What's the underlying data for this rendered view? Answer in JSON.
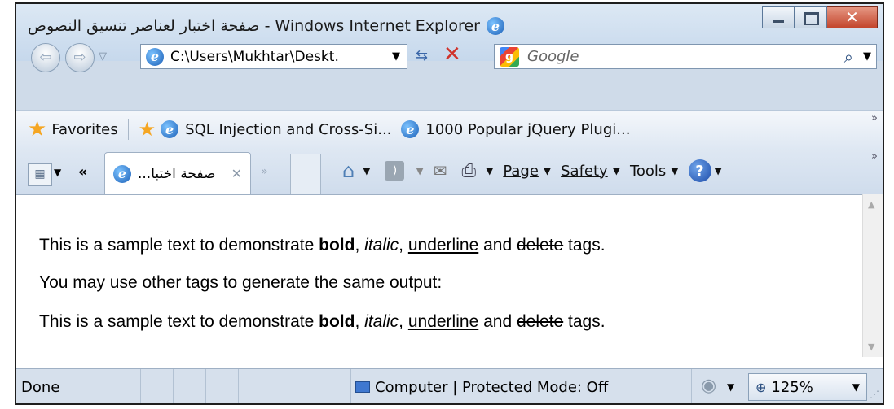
{
  "window": {
    "title": "صفحة اختبار لعناصر تنسيق النصوص - Windows Internet Explorer"
  },
  "address": {
    "url": "C:\\Users\\Mukhtar\\Deskt․"
  },
  "search": {
    "placeholder": "Google"
  },
  "favorites": {
    "label": "Favorites",
    "items": [
      {
        "label": "SQL Injection and Cross-Si..."
      },
      {
        "label": "1000 Popular jQuery Plugi..."
      }
    ]
  },
  "tabs": {
    "active_label": "...صفحة اختبا"
  },
  "commandbar": {
    "page": "Page",
    "safety": "Safety",
    "tools": "Tools"
  },
  "content": {
    "line1": {
      "before": "This is a sample text to demonstrate ",
      "bold": "bold",
      "comma1": ", ",
      "italic": "italic",
      "comma2": ", ",
      "underline": "underline",
      "and": " and ",
      "delete": "delete",
      "after": " tags."
    },
    "line2": "You may use other tags to generate the same output:",
    "line3": {
      "before": "This is a sample text to demonstrate ",
      "bold": "bold",
      "comma1": ", ",
      "italic": "italic",
      "comma2": ", ",
      "underline": "underline",
      "and": " and ",
      "delete": "delete",
      "after": " tags."
    }
  },
  "status": {
    "done": "Done",
    "zone": "Computer | Protected Mode: Off",
    "zoom": "125%"
  },
  "colors": {
    "close_button": "#c3452c",
    "chrome": "#cfdbe9"
  }
}
